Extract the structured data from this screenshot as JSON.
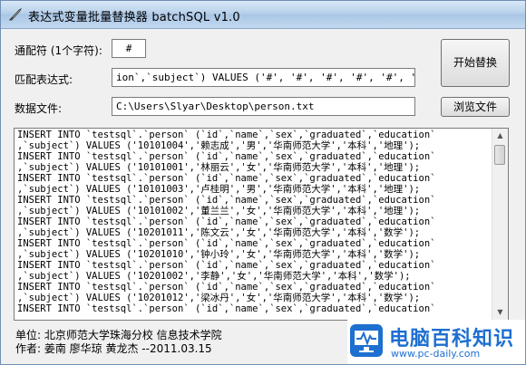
{
  "window": {
    "title": "表达式变量批量替换器 batchSQL v1.0"
  },
  "form": {
    "wildcard_label": "通配符 (1个字符):",
    "wildcard_value": "#",
    "regex_label": "匹配表达式:",
    "regex_value": "ion`,`subject`) VALUES ('#', '#', '#', '#', '#', '#');",
    "file_label": "数据文件:",
    "file_value": "C:\\Users\\Slyar\\Desktop\\person.txt",
    "start_button": "开始替换",
    "browse_button": "浏览文件"
  },
  "output": {
    "lines": [
      "INSERT INTO `testsql`.`person` (`id`,`name`,`sex`,`graduated`,`education`",
      ",`subject`) VALUES ('10101004','赖志成','男','华南师范大学','本科','地理');",
      "INSERT INTO `testsql`.`person` (`id`,`name`,`sex`,`graduated`,`education`",
      ",`subject`) VALUES ('10101001','林丽云','女','华南师范大学','本科','地理');",
      "INSERT INTO `testsql`.`person` (`id`,`name`,`sex`,`graduated`,`education`",
      ",`subject`) VALUES ('10101003','卢桂明','男','华南师范大学','本科','地理');",
      "INSERT INTO `testsql`.`person` (`id`,`name`,`sex`,`graduated`,`education`",
      ",`subject`) VALUES ('10101002','董兰兰','女','华南师范大学','本科','地理');",
      "INSERT INTO `testsql`.`person` (`id`,`name`,`sex`,`graduated`,`education`",
      ",`subject`) VALUES ('10201011','陈文云','女','华南师范大学','本科','数学');",
      "INSERT INTO `testsql`.`person` (`id`,`name`,`sex`,`graduated`,`education`",
      ",`subject`) VALUES ('10201010','钟小玲','女','华南师范大学','本科','数学');",
      "INSERT INTO `testsql`.`person` (`id`,`name`,`sex`,`graduated`,`education`",
      ",`subject`) VALUES ('10201002','李静','女','华南师范大学','本科','数学');",
      "INSERT INTO `testsql`.`person` (`id`,`name`,`sex`,`graduated`,`education`",
      ",`subject`) VALUES ('10201012','梁冰丹','女','华南师范大学','本科','数学');",
      "INSERT INTO `testsql`.`person` (`id`,`name`,`sex`,`graduated`,`education`"
    ]
  },
  "footer": {
    "unit": "单位: 北京师范大学珠海分校 信息技术学院",
    "author": "作者: 姜南 廖华琼 黄龙杰    --2011.03.15"
  },
  "watermark": {
    "title": "电脑百科知识",
    "url": "www.pc-daily.com"
  },
  "colors": {
    "accent": "#1d6fd0",
    "title_gradient": "#b9d1ea"
  }
}
